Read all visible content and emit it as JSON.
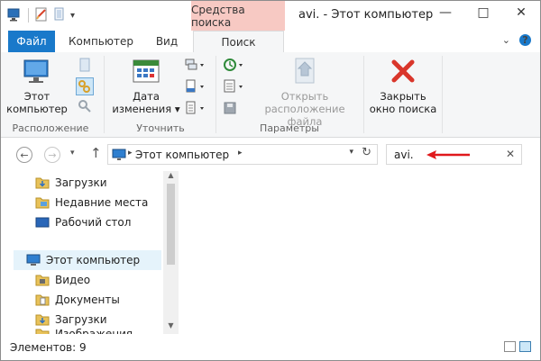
{
  "window": {
    "title": "avi. - Этот компьютер",
    "context_tab_header": "Средства поиска",
    "controls": {
      "minimize": "—",
      "maximize": "□",
      "close": "✕"
    }
  },
  "tabs": [
    {
      "label": "Файл"
    },
    {
      "label": "Компьютер"
    },
    {
      "label": "Вид"
    },
    {
      "label": "Поиск"
    }
  ],
  "ribbon": {
    "groups": [
      {
        "label": "Расположение",
        "buttons": [
          {
            "label_l1": "Этот",
            "label_l2": "компьютер"
          }
        ]
      },
      {
        "label": "Уточнить",
        "buttons": [
          {
            "label_l1": "Дата",
            "label_l2": "изменения ▾"
          }
        ]
      },
      {
        "label": "Параметры",
        "buttons": [
          {
            "label_l1": "Открыть",
            "label_l2": "расположение файла"
          }
        ]
      },
      {
        "label": "",
        "buttons": [
          {
            "label_l1": "Закрыть",
            "label_l2": "окно поиска"
          }
        ]
      }
    ]
  },
  "address": {
    "crumb": "Этот компьютер",
    "search_value": "avi."
  },
  "nav": {
    "items": [
      {
        "label": "Загрузки"
      },
      {
        "label": "Недавние места"
      },
      {
        "label": "Рабочий стол"
      },
      {
        "label": "Этот компьютер"
      },
      {
        "label": "Видео"
      },
      {
        "label": "Документы"
      },
      {
        "label": "Загрузки"
      },
      {
        "label": "Изображения"
      }
    ]
  },
  "status": {
    "items_text": "Элементов: 9"
  },
  "colors": {
    "file_tab": "#1979ca",
    "context_tab": "#f7c9c3",
    "arrow": "#e0181b"
  }
}
